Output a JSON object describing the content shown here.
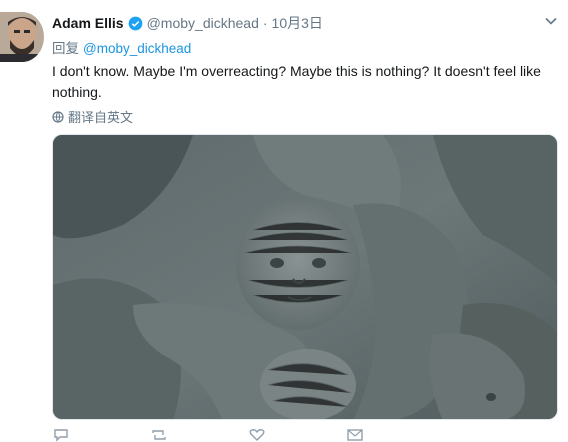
{
  "tweet": {
    "author_name": "Adam Ellis",
    "handle": "@moby_dickhead",
    "separator": "·",
    "date": "10月3日",
    "reply_prefix": "回复",
    "reply_mention": "@moby_dickhead",
    "text": "I don't know. Maybe I'm overreacting? Maybe this is nothing? It doesn't feel like nothing.",
    "translate_label": "翻译自英文"
  },
  "icons": {
    "verified": "verified-badge-icon",
    "caret": "chevron-down-icon",
    "translate": "globe-icon"
  },
  "colors": {
    "link": "#1b95e0",
    "muted": "#657786",
    "text": "#14171a"
  }
}
